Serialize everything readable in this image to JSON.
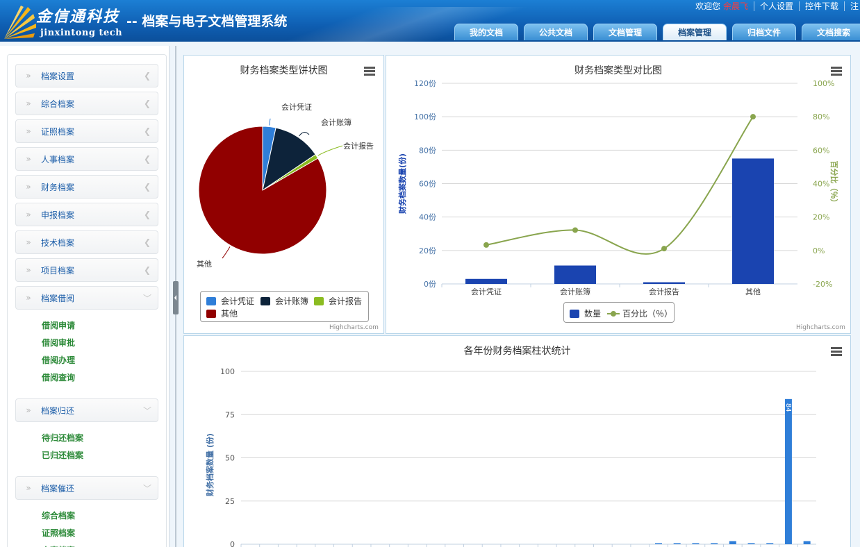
{
  "header": {
    "logo_cn": "金信通科技",
    "logo_en": "jinxintong tech",
    "system_title": "-- 档案与电子文档管理系统",
    "welcome": "欢迎您",
    "user_name": "余晨飞",
    "links": [
      "个人设置",
      "控件下载",
      "注"
    ],
    "tabs": [
      {
        "label": "我的文档",
        "active": false
      },
      {
        "label": "公共文档",
        "active": false
      },
      {
        "label": "文档管理",
        "active": false
      },
      {
        "label": "档案管理",
        "active": true
      },
      {
        "label": "归档文件",
        "active": false
      },
      {
        "label": "文档搜索",
        "active": false
      }
    ]
  },
  "sidebar": {
    "menus": [
      {
        "label": "档案设置",
        "expanded": false
      },
      {
        "label": "综合档案",
        "expanded": false
      },
      {
        "label": "证照档案",
        "expanded": false
      },
      {
        "label": "人事档案",
        "expanded": false
      },
      {
        "label": "财务档案",
        "expanded": false
      },
      {
        "label": "申报档案",
        "expanded": false
      },
      {
        "label": "技术档案",
        "expanded": false
      },
      {
        "label": "项目档案",
        "expanded": false
      },
      {
        "label": "档案借阅",
        "expanded": true,
        "children": [
          "借阅申请",
          "借阅审批",
          "借阅办理",
          "借阅查询"
        ]
      },
      {
        "label": "档案归还",
        "expanded": true,
        "children": [
          "待归还档案",
          "已归还档案"
        ]
      },
      {
        "label": "档案催还",
        "expanded": true,
        "children": [
          "综合档案",
          "证照档案",
          "人事档案"
        ]
      }
    ]
  },
  "credit": "Highcharts.com",
  "chart_data": [
    {
      "type": "pie",
      "title": "财务档案类型饼状图",
      "slices": [
        {
          "name": "会计凭证",
          "value": 3,
          "color": "#2f7ed8"
        },
        {
          "name": "会计账簿",
          "value": 11,
          "color": "#0d233a"
        },
        {
          "name": "会计报告",
          "value": 1,
          "color": "#8bbc21"
        },
        {
          "name": "其他",
          "value": 75,
          "color": "#910000"
        }
      ],
      "legend": "bottom"
    },
    {
      "type": "bar",
      "title": "财务档案类型对比图",
      "categories": [
        "会计凭证",
        "会计账簿",
        "会计报告",
        "其他"
      ],
      "series": [
        {
          "name": "数量",
          "type": "bar",
          "axis": "left",
          "color": "#1a44b0",
          "values": [
            3,
            11,
            1,
            75
          ]
        },
        {
          "name": "百分比（％）",
          "type": "line",
          "axis": "right",
          "color": "#89a54e",
          "values": [
            3.3,
            12.2,
            1.1,
            80
          ]
        }
      ],
      "ylabel": "财务档案数量(份)",
      "y2label": "百分比（％）",
      "ylim": [
        0,
        120
      ],
      "y2lim": [
        -20,
        100
      ],
      "yticks": [
        "0份",
        "20份",
        "40份",
        "60份",
        "80份",
        "100份",
        "120份"
      ],
      "y2ticks": [
        "-20%",
        "0%",
        "20%",
        "40%",
        "60%",
        "80%",
        "100%"
      ],
      "legend": "bottom",
      "grid": true
    },
    {
      "type": "bar",
      "title": "各年份财务档案柱状统计",
      "ylabel": "财务档案数量 (份)",
      "ylim": [
        0,
        100
      ],
      "yticks": [
        "0",
        "25",
        "50",
        "75",
        "100"
      ],
      "values": [
        0,
        0,
        0,
        0,
        0,
        0,
        0,
        0,
        0,
        0,
        0,
        0,
        0,
        0,
        0,
        0,
        0,
        0,
        0,
        0,
        0,
        0,
        0.6,
        0.6,
        0.6,
        0.6,
        1.8,
        0.6,
        0.6,
        84,
        1.8
      ],
      "data_labels": {
        "29": "84"
      },
      "color": "#2f7ed8",
      "grid": true
    }
  ]
}
